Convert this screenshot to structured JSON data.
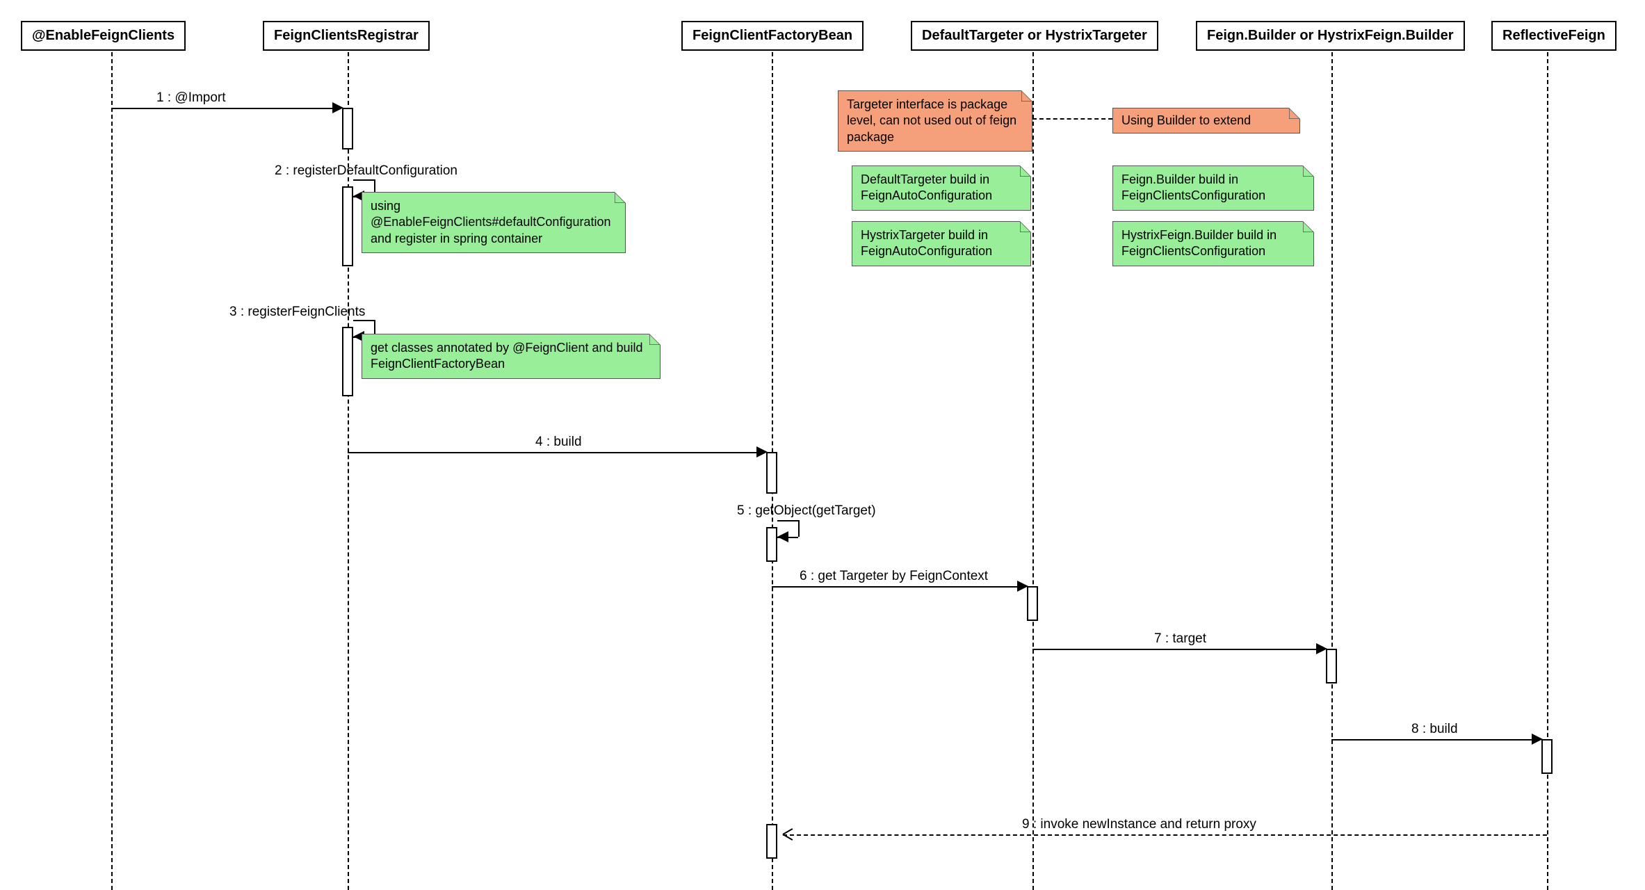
{
  "participants": {
    "p1": "@EnableFeignClients",
    "p2": "FeignClientsRegistrar",
    "p3": "FeignClientFactoryBean",
    "p4": "DefaultTargeter or HystrixTargeter",
    "p5": "Feign.Builder or HystrixFeign.Builder",
    "p6": "ReflectiveFeign"
  },
  "messages": {
    "m1": "1 : @Import",
    "m2": "2 : registerDefaultConfiguration",
    "m3": "3 : registerFeignClients",
    "m4": "4 : build",
    "m5": "5 : getObject(getTarget)",
    "m6": "6 : get Targeter by FeignContext",
    "m7": "7 : target",
    "m8": "8 : build",
    "m9": "9 : invoke newInstance and return proxy"
  },
  "notes": {
    "n1": "using @EnableFeignClients#defaultConfiguration and register in spring container",
    "n2": "get classes annotated by @FeignClient and build FeignClientFactoryBean",
    "n3": "Targeter interface is package level, can not used out of feign package",
    "n4": "DefaultTargeter build in FeignAutoConfiguration",
    "n5": "HystrixTargeter build in FeignAutoConfiguration",
    "n6": "Using Builder to extend",
    "n7": "Feign.Builder build in FeignClientsConfiguration",
    "n8": "HystrixFeign.Builder build in FeignClientsConfiguration"
  },
  "colors": {
    "green": "#98ee99",
    "orange": "#f5a07a"
  }
}
